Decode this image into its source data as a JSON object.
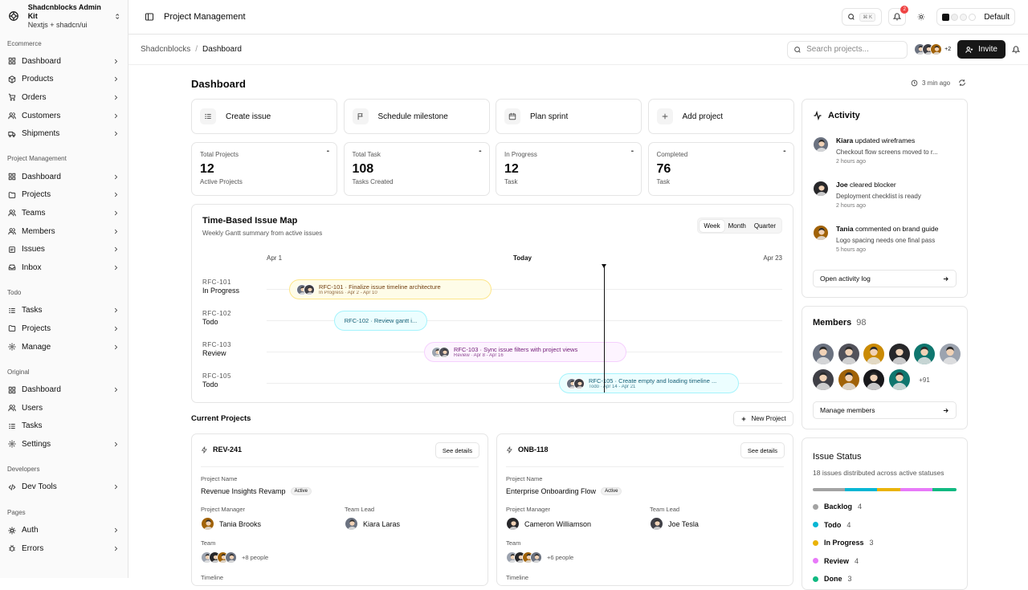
{
  "brand": {
    "title": "Shadcnblocks Admin Kit",
    "subtitle": "Nextjs + shadcn/ui"
  },
  "sidebar": {
    "groups": [
      {
        "label": "Ecommerce",
        "items": [
          {
            "label": "Dashboard",
            "icon": "dashboard-icon",
            "chev": true
          },
          {
            "label": "Products",
            "icon": "box-icon",
            "chev": true
          },
          {
            "label": "Orders",
            "icon": "orders-icon",
            "chev": true
          },
          {
            "label": "Customers",
            "icon": "users-icon",
            "chev": true
          },
          {
            "label": "Shipments",
            "icon": "truck-icon",
            "chev": true
          }
        ]
      },
      {
        "label": "Project Management",
        "items": [
          {
            "label": "Dashboard",
            "icon": "dashboard-icon",
            "chev": true
          },
          {
            "label": "Projects",
            "icon": "folder-icon",
            "chev": true
          },
          {
            "label": "Teams",
            "icon": "users-icon",
            "chev": true
          },
          {
            "label": "Members",
            "icon": "users-icon",
            "chev": true
          },
          {
            "label": "Issues",
            "icon": "issues-icon",
            "chev": true
          },
          {
            "label": "Inbox",
            "icon": "inbox-icon",
            "chev": true
          }
        ]
      },
      {
        "label": "Todo",
        "items": [
          {
            "label": "Tasks",
            "icon": "tasks-icon",
            "chev": true
          },
          {
            "label": "Projects",
            "icon": "folder-icon",
            "chev": true
          },
          {
            "label": "Manage",
            "icon": "gear-icon",
            "chev": true
          }
        ]
      },
      {
        "label": "Original",
        "items": [
          {
            "label": "Dashboard",
            "icon": "dashboard-icon",
            "chev": true
          },
          {
            "label": "Users",
            "icon": "users-icon",
            "chev": false
          },
          {
            "label": "Tasks",
            "icon": "tasks-icon",
            "chev": false
          },
          {
            "label": "Settings",
            "icon": "gear-icon",
            "chev": true
          }
        ]
      },
      {
        "label": "Developers",
        "items": [
          {
            "label": "Dev Tools",
            "icon": "code-icon",
            "chev": true
          }
        ]
      },
      {
        "label": "Pages",
        "items": [
          {
            "label": "Auth",
            "icon": "auth-icon",
            "chev": true
          },
          {
            "label": "Errors",
            "icon": "bug-icon",
            "chev": true
          }
        ]
      }
    ]
  },
  "topbar": {
    "title": "Project Management",
    "kbd": "⌘ K",
    "notif_count": "2",
    "theme": "Default"
  },
  "subbar": {
    "crumb1": "Shadcnblocks",
    "crumb2": "Dashboard",
    "search_placeholder": "Search projects...",
    "more": "+2",
    "invite": "Invite"
  },
  "dashboard": {
    "title": "Dashboard",
    "updated": "3 min ago"
  },
  "quick_actions": [
    {
      "label": "Create issue",
      "icon": "list-icon"
    },
    {
      "label": "Schedule milestone",
      "icon": "flag-icon"
    },
    {
      "label": "Plan sprint",
      "icon": "calendar-icon"
    },
    {
      "label": "Add project",
      "icon": "plus-icon"
    }
  ],
  "stats": [
    {
      "label": "Total Projects",
      "value": "12",
      "sub": "Active Projects"
    },
    {
      "label": "Total Task",
      "value": "108",
      "sub": "Tasks Created"
    },
    {
      "label": "In Progress",
      "value": "12",
      "sub": "Task"
    },
    {
      "label": "Completed",
      "value": "76",
      "sub": "Task"
    }
  ],
  "gantt": {
    "title": "Time-Based Issue Map",
    "subtitle": "Weekly Gantt summary from active issues",
    "tabs": [
      "Week",
      "Month",
      "Quarter"
    ],
    "active_tab": "Week",
    "axis": {
      "start": "Apr 1",
      "today": "Today",
      "end": "Apr 23"
    },
    "rows": [
      {
        "id": "RFC-101",
        "status": "In Progress",
        "bar": "RFC-101 · Finalize issue timeline architecture",
        "meta": "In Progress · Apr 2 - Apr 10",
        "avatars": 2,
        "color": "#fefce8",
        "border": "#fde68a",
        "text": "#713f12"
      },
      {
        "id": "RFC-102",
        "status": "Todo",
        "bar": "RFC-102 · Review gantt i...",
        "meta": "",
        "avatars": 0,
        "color": "#ecfeff",
        "border": "#a5f3fc",
        "text": "#155e75"
      },
      {
        "id": "RFC-103",
        "status": "Review",
        "bar": "RFC-103 · Sync issue filters with project views",
        "meta": "Review · Apr 8 - Apr 16",
        "avatars": 2,
        "color": "#fdf4ff",
        "border": "#f5d0fe",
        "text": "#701a75"
      },
      {
        "id": "RFC-105",
        "status": "Todo",
        "bar": "RFC-105 · Create empty and loading timeline ...",
        "meta": "Todo · Apr 14 - Apr 21",
        "avatars": 2,
        "color": "#ecfeff",
        "border": "#a5f3fc",
        "text": "#155e75"
      }
    ]
  },
  "projects": {
    "title": "Current Projects",
    "new_label": "New Project",
    "cards": [
      {
        "code": "REV-241",
        "details": "See details",
        "name_label": "Project Name",
        "name": "Revenue Insights Revamp",
        "status": "Active",
        "pm_label": "Project Manager",
        "pm": "Tania Brooks",
        "tl_label": "Team Lead",
        "tl": "Kiara Laras",
        "team_label": "Team",
        "team_more": "+8 people",
        "timeline_label": "Timeline"
      },
      {
        "code": "ONB-118",
        "details": "See details",
        "name_label": "Project Name",
        "name": "Enterprise Onboarding Flow",
        "status": "Active",
        "pm_label": "Project Manager",
        "pm": "Cameron Williamson",
        "tl_label": "Team Lead",
        "tl": "Joe Tesla",
        "team_label": "Team",
        "team_more": "+6 people",
        "timeline_label": "Timeline"
      }
    ]
  },
  "activity": {
    "title": "Activity",
    "items": [
      {
        "name": "Kiara",
        "action": "updated wireframes",
        "detail": "Checkout flow screens moved to r...",
        "time": "2 hours ago"
      },
      {
        "name": "Joe",
        "action": "cleared blocker",
        "detail": "Deployment checklist is ready",
        "time": "2 hours ago"
      },
      {
        "name": "Tania",
        "action": "commented on brand guide",
        "detail": "Logo spacing needs one final pass",
        "time": "5 hours ago"
      }
    ],
    "button": "Open activity log"
  },
  "members": {
    "title": "Members",
    "count": "98",
    "more": "+91",
    "button": "Manage members"
  },
  "issue_status": {
    "title": "Issue Status",
    "subtitle": "18 issues distributed across active statuses",
    "statuses": [
      {
        "label": "Backlog",
        "count": "4",
        "color": "#a3a3a3"
      },
      {
        "label": "Todo",
        "count": "4",
        "color": "#06b6d4"
      },
      {
        "label": "In Progress",
        "count": "3",
        "color": "#eab308"
      },
      {
        "label": "Review",
        "count": "4",
        "color": "#e879f9"
      },
      {
        "label": "Done",
        "count": "3",
        "color": "#10b981"
      }
    ]
  }
}
